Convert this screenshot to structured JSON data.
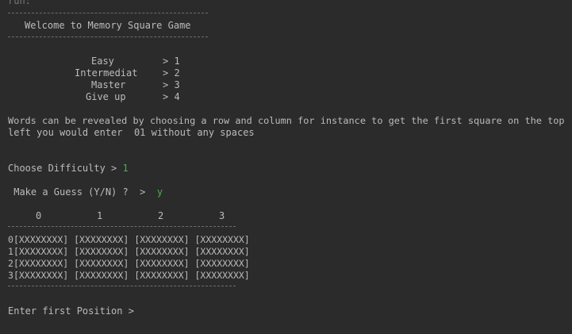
{
  "console": {
    "header_run": "run:",
    "welcome": "Welcome to Memory Square Game",
    "menu": [
      {
        "label": "Easy",
        "key": "> 1"
      },
      {
        "label": "Intermediat",
        "key": "> 2"
      },
      {
        "label": "Master",
        "key": "> 3"
      },
      {
        "label": "Give up",
        "key": "> 4"
      }
    ],
    "instructions_line1": "Words can be revealed by choosing a row and column for instance to get the first square on the top",
    "instructions_line2": "left you would enter  01 without any spaces",
    "difficulty_prompt": "Choose Difficulty > ",
    "difficulty_input": "1",
    "guess_prompt": " Make a Guess (Y/N) ?  >  ",
    "guess_input": "y",
    "column_headers": [
      "0",
      "1",
      "2",
      "3"
    ],
    "grid_rows": [
      {
        "index": "0",
        "cells": [
          "[XXXXXXXX]",
          "[XXXXXXXX]",
          "[XXXXXXXX]",
          "[XXXXXXXX]"
        ]
      },
      {
        "index": "1",
        "cells": [
          "[XXXXXXXX]",
          "[XXXXXXXX]",
          "[XXXXXXXX]",
          "[XXXXXXXX]"
        ]
      },
      {
        "index": "2",
        "cells": [
          "[XXXXXXXX]",
          "[XXXXXXXX]",
          "[XXXXXXXX]",
          "[XXXXXXXX]"
        ]
      },
      {
        "index": "3",
        "cells": [
          "[XXXXXXXX]",
          "[XXXXXXXX]",
          "[XXXXXXXX]",
          "[XXXXXXXX]"
        ]
      }
    ],
    "position_prompt": "Enter first Position >"
  },
  "colors": {
    "background": "#2b2b2b",
    "text": "#bbbbbb",
    "input": "#4caf50",
    "rule": "#6e6e6e"
  }
}
